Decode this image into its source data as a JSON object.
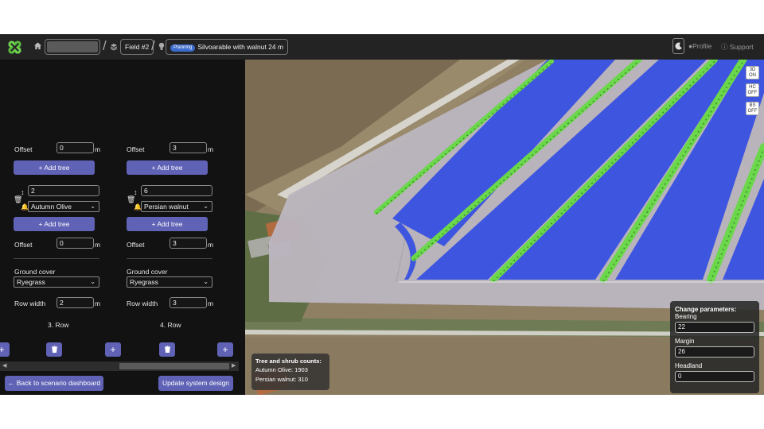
{
  "topbar": {
    "breadcrumb": {
      "field": "Field #2",
      "status_badge": "Planning",
      "scenario": "Silvoarable with walnut 24 m"
    },
    "profile_label": "Profile",
    "support_label": "Support"
  },
  "rows": [
    {
      "offset_top_label": "Offset",
      "offset_top": "0",
      "unit": "m",
      "add_tree_label": "Add tree",
      "tree_count": "2",
      "species": "Autumn Olive",
      "offset_bottom": "0",
      "ground_cover_label": "Ground cover",
      "ground_cover": "Ryegrass",
      "row_width_label": "Row width",
      "row_width": "2",
      "row_title": "3. Row"
    },
    {
      "offset_top_label": "Offset",
      "offset_top": "3",
      "unit": "m",
      "add_tree_label": "Add tree",
      "tree_count": "6",
      "species": "Persian walnut",
      "offset_bottom": "3",
      "ground_cover_label": "Ground cover",
      "ground_cover": "Ryegrass",
      "row_width_label": "Row width",
      "row_width": "3",
      "row_title": "4. Row"
    }
  ],
  "footer": {
    "back_label": "Back to scenario dashboard",
    "update_label": "Update system design"
  },
  "map_controls": [
    {
      "top": "3D",
      "bottom": "ON"
    },
    {
      "top": "HC",
      "bottom": "OFF"
    },
    {
      "top": "BS",
      "bottom": "OFF"
    }
  ],
  "counts": {
    "title": "Tree and shrub counts:",
    "lines": [
      "Autumn Olive: 1903",
      "Persian walnut: 310"
    ]
  },
  "params": {
    "title": "Change parameters:",
    "bearing_label": "Bearing",
    "bearing": "22",
    "margin_label": "Margin",
    "margin": "26",
    "headland_label": "Headland",
    "headland": "0"
  },
  "colors": {
    "accent": "#5f62b5",
    "crop_strip": "#3e55e0",
    "tree_row": "#6ad84a",
    "field_outline": "#b9b4bd"
  }
}
